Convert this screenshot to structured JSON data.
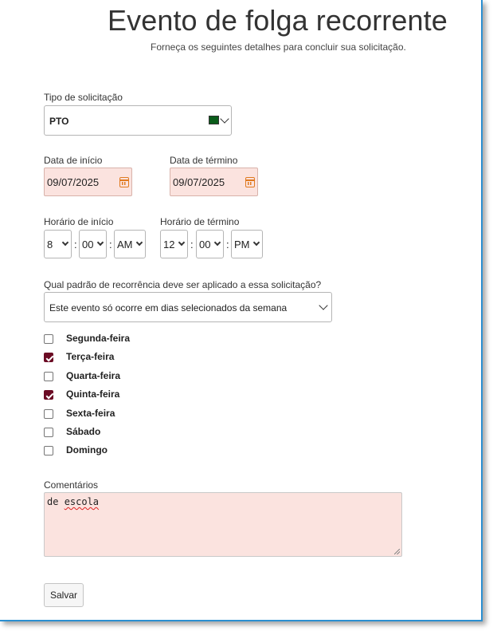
{
  "page": {
    "title": "Evento de folga recorrente",
    "subtitle": "Forneça os seguintes detalhes para concluir sua solicitação."
  },
  "request_type": {
    "label": "Tipo de solicitação",
    "value": "PTO",
    "color_swatch": "#0a5c1a"
  },
  "dates": {
    "start_label": "Data de início",
    "start_value": "09/07/2025",
    "end_label": "Data de término",
    "end_value": "09/07/2025",
    "icon": "calendar-icon",
    "field_bg": "#fbe3df",
    "icon_color": "#e07a20"
  },
  "times": {
    "start_label": "Horário de início",
    "start_hour": "8",
    "start_minute": "00",
    "start_ampm": "AM",
    "end_label": "Horário de término",
    "end_hour": "12",
    "end_minute": "00",
    "end_ampm": "PM",
    "separator": ":"
  },
  "recurrence": {
    "label": "Qual padrão de recorrência deve ser aplicado a essa solicitação?",
    "value": "Este evento só ocorre em dias selecionados da semana"
  },
  "days": [
    {
      "label": "Segunda-feira",
      "checked": false
    },
    {
      "label": "Terça-feira",
      "checked": true
    },
    {
      "label": "Quarta-feira",
      "checked": false
    },
    {
      "label": "Quinta-feira",
      "checked": true
    },
    {
      "label": "Sexta-feira",
      "checked": false
    },
    {
      "label": "Sábado",
      "checked": false
    },
    {
      "label": "Domingo",
      "checked": false
    }
  ],
  "comments": {
    "label": "Comentários",
    "value_part1": "de ",
    "value_part2": "escola"
  },
  "actions": {
    "save_label": "Salvar"
  },
  "colors": {
    "frame_border": "#2b8fd1",
    "checkbox_checked": "#6b0b24"
  }
}
